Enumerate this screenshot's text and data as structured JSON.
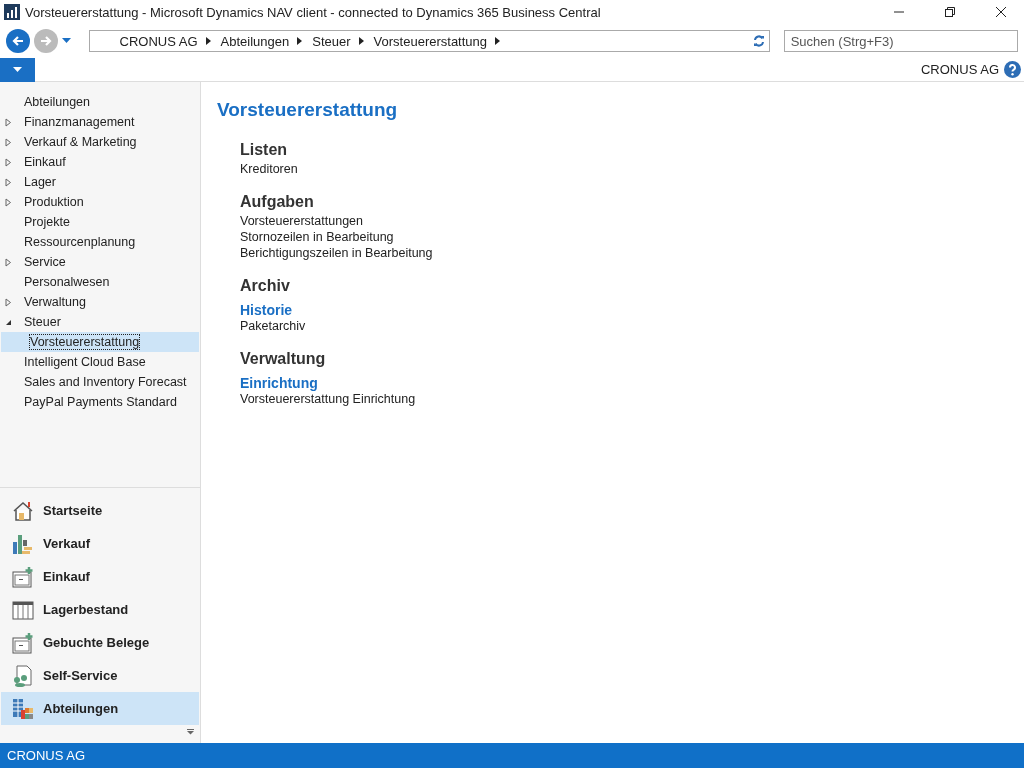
{
  "window": {
    "title": "Vorsteuererstattung - Microsoft Dynamics NAV client - connected to Dynamics 365 Business Central"
  },
  "address_bar": {
    "breadcrumbs": [
      "CRONUS AG",
      "Abteilungen",
      "Steuer",
      "Vorsteuererstattung"
    ]
  },
  "search": {
    "placeholder": "Suchen (Strg+F3)"
  },
  "company": "CRONUS AG",
  "sidebar": {
    "items": [
      {
        "label": "Abteilungen",
        "kind": "leaf",
        "selected": false
      },
      {
        "label": "Finanzmanagement",
        "kind": "group",
        "expanded": false,
        "selected": false
      },
      {
        "label": "Verkauf & Marketing",
        "kind": "group",
        "expanded": false,
        "selected": false
      },
      {
        "label": "Einkauf",
        "kind": "group",
        "expanded": false,
        "selected": false
      },
      {
        "label": "Lager",
        "kind": "group",
        "expanded": false,
        "selected": false
      },
      {
        "label": "Produktion",
        "kind": "group",
        "expanded": false,
        "selected": false
      },
      {
        "label": "Projekte",
        "kind": "leaf",
        "selected": false
      },
      {
        "label": "Ressourcenplanung",
        "kind": "leaf",
        "selected": false
      },
      {
        "label": "Service",
        "kind": "group",
        "expanded": false,
        "selected": false
      },
      {
        "label": "Personalwesen",
        "kind": "leaf",
        "selected": false
      },
      {
        "label": "Verwaltung",
        "kind": "group",
        "expanded": false,
        "selected": false
      },
      {
        "label": "Steuer",
        "kind": "group",
        "expanded": true,
        "selected": false,
        "children": [
          {
            "label": "Vorsteuererstattung",
            "selected": true
          }
        ]
      },
      {
        "label": "Intelligent Cloud Base",
        "kind": "leaf",
        "selected": false
      },
      {
        "label": "Sales and Inventory Forecast",
        "kind": "leaf",
        "selected": false
      },
      {
        "label": "PayPal Payments Standard",
        "kind": "leaf",
        "selected": false
      }
    ]
  },
  "navigation_pane": {
    "buttons": [
      {
        "label": "Startseite",
        "kind": "home",
        "selected": false
      },
      {
        "label": "Verkauf",
        "kind": "sales",
        "selected": false
      },
      {
        "label": "Einkauf",
        "kind": "purchase",
        "selected": false
      },
      {
        "label": "Lagerbestand",
        "kind": "inventory",
        "selected": false
      },
      {
        "label": "Gebuchte Belege",
        "kind": "purchase",
        "selected": false
      },
      {
        "label": "Self-Service",
        "kind": "selfservice",
        "selected": false
      },
      {
        "label": "Abteilungen",
        "kind": "departments",
        "selected": true
      }
    ]
  },
  "content": {
    "title": "Vorsteuererstattung",
    "sections": [
      {
        "heading": "Listen",
        "groups": [
          {
            "links": [
              "Kreditoren"
            ]
          }
        ]
      },
      {
        "heading": "Aufgaben",
        "groups": [
          {
            "links": [
              "Vorsteuererstattungen",
              "Stornozeilen in Bearbeitung",
              "Berichtigungszeilen in Bearbeitung"
            ]
          }
        ]
      },
      {
        "heading": "Archiv",
        "groups": [
          {
            "subheading": "Historie",
            "links": [
              "Paketarchiv"
            ]
          }
        ]
      },
      {
        "heading": "Verwaltung",
        "groups": [
          {
            "subheading": "Einrichtung",
            "links": [
              "Vorsteuererstattung Einrichtung"
            ]
          }
        ]
      }
    ]
  },
  "status_bar": {
    "company": "CRONUS AG"
  }
}
